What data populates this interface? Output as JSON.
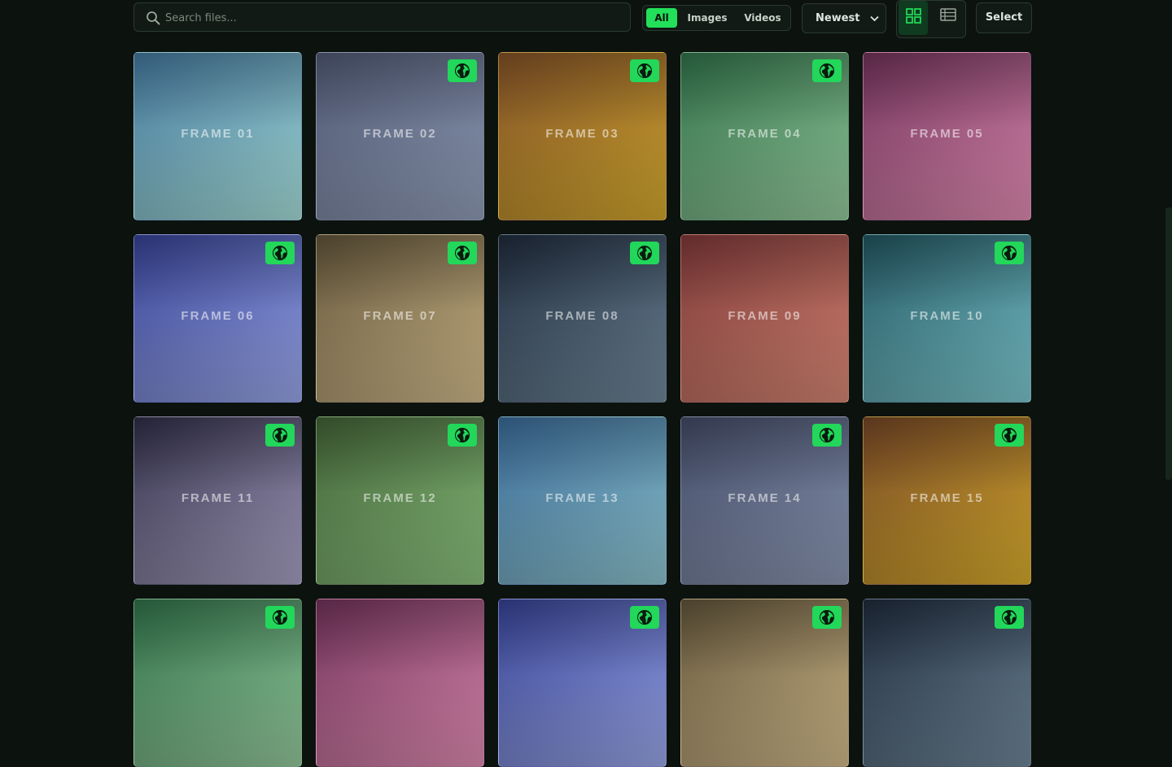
{
  "search": {
    "placeholder": "Search files...",
    "value": ""
  },
  "filters": [
    {
      "label": "All",
      "active": true
    },
    {
      "label": "Images",
      "active": false
    },
    {
      "label": "Videos",
      "active": false
    }
  ],
  "sort": {
    "selected": "Newest"
  },
  "view": {
    "active": "grid"
  },
  "select_label": "Select",
  "colors": {
    "accent": "#22e05a",
    "badge": "#22d75a",
    "background": "#0c120e"
  },
  "tiles": [
    {
      "label": "FRAME 01",
      "public": false,
      "colors": [
        "#3e6f94",
        "#a4dbd6"
      ]
    },
    {
      "label": "FRAME 02",
      "public": true,
      "colors": [
        "#4a536c",
        "#8f9bb5"
      ]
    },
    {
      "label": "FRAME 03",
      "public": true,
      "colors": [
        "#7a4c25",
        "#d0a62e"
      ]
    },
    {
      "label": "FRAME 04",
      "public": true,
      "colors": [
        "#2d6b45",
        "#93c79a"
      ]
    },
    {
      "label": "FRAME 05",
      "public": false,
      "colors": [
        "#6a2f55",
        "#dd8ab0"
      ]
    },
    {
      "label": "FRAME 06",
      "public": true,
      "colors": [
        "#323e8c",
        "#98a5e6"
      ]
    },
    {
      "label": "FRAME 07",
      "public": true,
      "colors": [
        "#5b4f36",
        "#d0b98a"
      ]
    },
    {
      "label": "FRAME 08",
      "public": true,
      "colors": [
        "#1d2838",
        "#6e8698"
      ]
    },
    {
      "label": "FRAME 09",
      "public": false,
      "colors": [
        "#773535",
        "#d48572"
      ]
    },
    {
      "label": "FRAME 10",
      "public": true,
      "colors": [
        "#1f4f5a",
        "#7bc5cc"
      ]
    },
    {
      "label": "FRAME 11",
      "public": true,
      "colors": [
        "#2c2a42",
        "#a69fc0"
      ]
    },
    {
      "label": "FRAME 12",
      "public": true,
      "colors": [
        "#3d5c33",
        "#8abe7c"
      ]
    },
    {
      "label": "FRAME 13",
      "public": false,
      "colors": [
        "#36648f",
        "#8cc1cc"
      ]
    },
    {
      "label": "FRAME 14",
      "public": true,
      "colors": [
        "#3e4660",
        "#8995b0"
      ]
    },
    {
      "label": "FRAME 15",
      "public": true,
      "colors": [
        "#6e4224",
        "#d5aa2c"
      ]
    },
    {
      "label": "",
      "public": true,
      "colors": [
        "#2d6b45",
        "#93c79a"
      ]
    },
    {
      "label": "",
      "public": false,
      "colors": [
        "#6a2f55",
        "#dd8ab0"
      ]
    },
    {
      "label": "",
      "public": true,
      "colors": [
        "#323e8c",
        "#98a5e6"
      ]
    },
    {
      "label": "",
      "public": true,
      "colors": [
        "#5b4f36",
        "#d0b98a"
      ]
    },
    {
      "label": "",
      "public": true,
      "colors": [
        "#1d2838",
        "#6e8698"
      ]
    }
  ]
}
